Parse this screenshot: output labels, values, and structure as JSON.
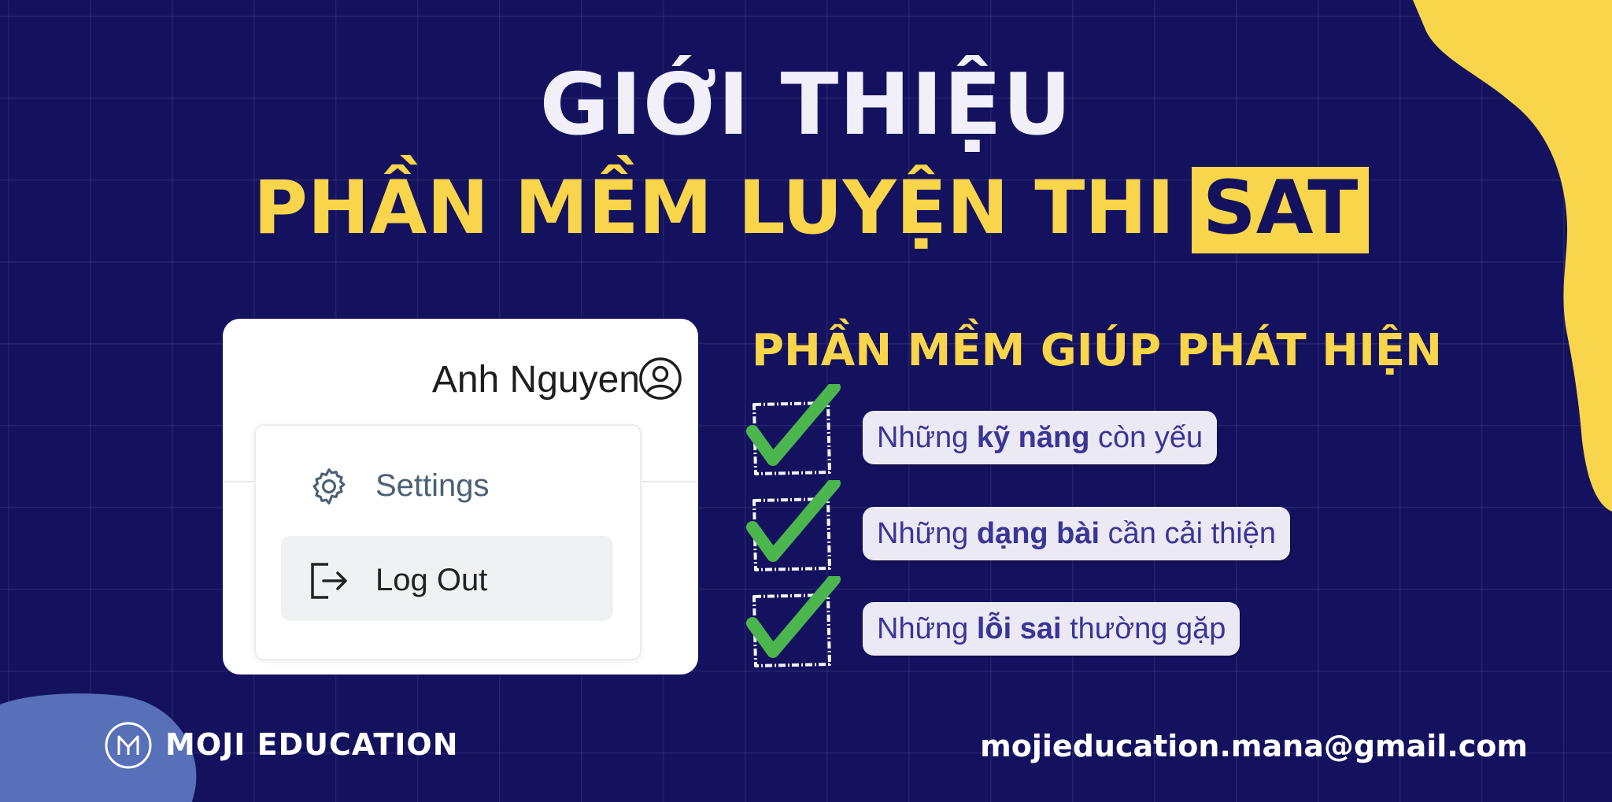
{
  "colors": {
    "background": "#14125e",
    "accent_yellow": "#f8d54a",
    "blob_blue": "#5770b8",
    "check_green": "#4cb64e",
    "pill_text": "#3a3598"
  },
  "header": {
    "title_line1": "GIỚI THIỆU",
    "title_line2": "PHẦN MỀM LUYỆN THI",
    "title_highlight": "SAT"
  },
  "card": {
    "user_name": "Anh Nguyen",
    "user_icon": "user-circle-icon",
    "menu": [
      {
        "label": "Settings",
        "icon": "gear-icon"
      },
      {
        "label": "Log Out",
        "icon": "logout-icon"
      }
    ]
  },
  "features": {
    "heading": "PHẦN MỀM GIÚP PHÁT HIỆN",
    "items": [
      {
        "prefix": "Những ",
        "bold": "kỹ năng",
        "suffix": " còn yếu"
      },
      {
        "prefix": "Những ",
        "bold": "dạng bài",
        "suffix": " cần cải thiện"
      },
      {
        "prefix": "Những ",
        "bold": "lỗi sai",
        "suffix": " thường gặp"
      }
    ]
  },
  "footer": {
    "brand": "MOJI EDUCATION",
    "logo_icon": "moji-logo-icon",
    "email": "mojieducation.mana@gmail.com"
  }
}
